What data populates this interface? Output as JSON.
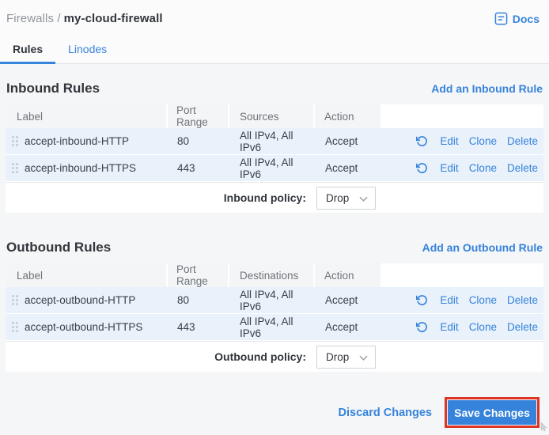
{
  "header": {
    "breadcrumb": {
      "section": "Firewalls /",
      "name": "my-cloud-firewall"
    },
    "docs_label": "Docs",
    "tabs": [
      {
        "label": "Rules",
        "active": true
      },
      {
        "label": "Linodes",
        "active": false
      }
    ]
  },
  "row_actions": {
    "edit": "Edit",
    "clone": "Clone",
    "delete": "Delete"
  },
  "inbound": {
    "title": "Inbound Rules",
    "add_rule_label": "Add an Inbound Rule",
    "columns": {
      "label": "Label",
      "port": "Port Range",
      "addresses": "Sources",
      "action": "Action"
    },
    "rows": [
      {
        "label": "accept-inbound-HTTP",
        "port": "80",
        "addresses": "All IPv4, All IPv6",
        "action": "Accept"
      },
      {
        "label": "accept-inbound-HTTPS",
        "port": "443",
        "addresses": "All IPv4, All IPv6",
        "action": "Accept"
      }
    ],
    "policy": {
      "label": "Inbound policy:",
      "value": "Drop"
    }
  },
  "outbound": {
    "title": "Outbound Rules",
    "add_rule_label": "Add an Outbound Rule",
    "columns": {
      "label": "Label",
      "port": "Port Range",
      "addresses": "Destinations",
      "action": "Action"
    },
    "rows": [
      {
        "label": "accept-outbound-HTTP",
        "port": "80",
        "addresses": "All IPv4, All IPv6",
        "action": "Accept"
      },
      {
        "label": "accept-outbound-HTTPS",
        "port": "443",
        "addresses": "All IPv4, All IPv6",
        "action": "Accept"
      }
    ],
    "policy": {
      "label": "Outbound policy:",
      "value": "Drop"
    }
  },
  "footer": {
    "discard_label": "Discard Changes",
    "save_label": "Save Changes"
  },
  "icons": {
    "docs": "docs-icon",
    "drag": "drag-handle-icon",
    "undo": "undo-icon",
    "chevron": "chevron-down-icon"
  },
  "colors": {
    "accent_blue": "#3683dc",
    "modified_row_bg": "#e9f1fa",
    "annotation_red": "#dd3426",
    "heading_text": "#32363c"
  }
}
